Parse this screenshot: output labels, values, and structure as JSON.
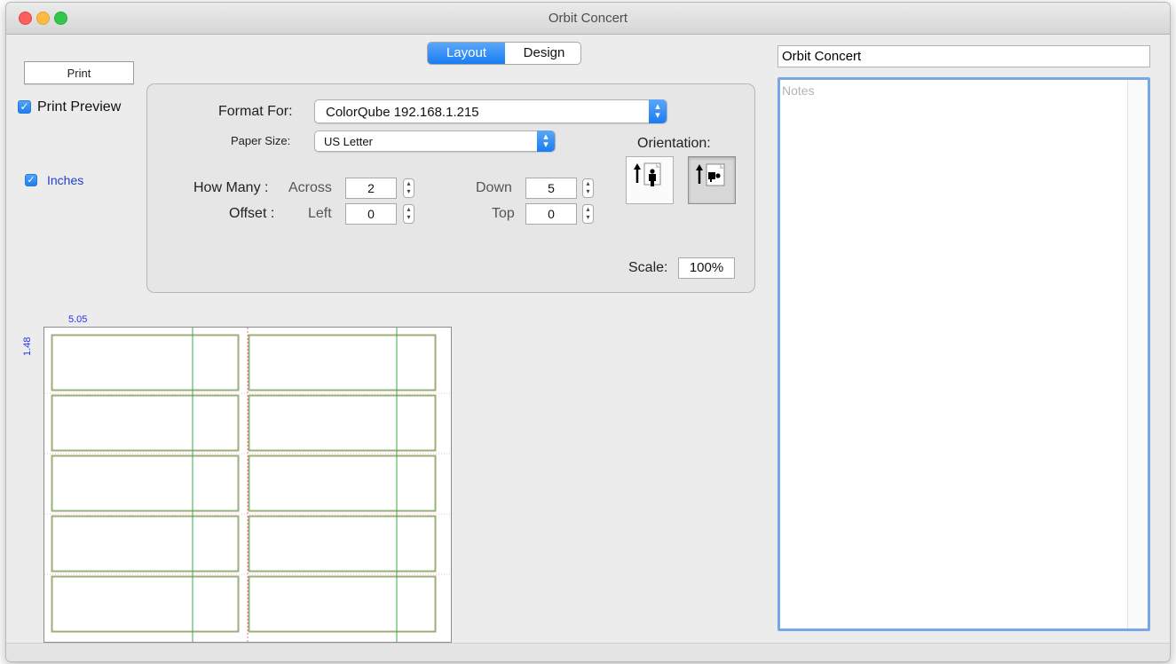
{
  "window": {
    "title": "Orbit Concert"
  },
  "tabs": {
    "layout": "Layout",
    "design": "Design",
    "selected": "Layout"
  },
  "left": {
    "print_label": "Print",
    "print_preview_label": "Print Preview",
    "print_preview_checked": true,
    "inches_label": "Inches",
    "inches_checked": true
  },
  "format": {
    "format_for_label": "Format For:",
    "format_for_value": "ColorQube 192.168.1.215",
    "paper_size_label": "Paper Size:",
    "paper_size_value": "US Letter",
    "orientation_label": "Orientation:",
    "orientation_selected": "landscape",
    "how_many_label": "How Many :",
    "across_label": "Across",
    "across_value": "2",
    "down_label": "Down",
    "down_value": "5",
    "offset_label": "Offset :",
    "left_label": "Left",
    "left_value": "0",
    "top_label": "Top",
    "top_value": "0",
    "scale_label": "Scale:",
    "scale_value": "100%"
  },
  "preview": {
    "width_label": "5.05",
    "height_label": "1.48",
    "columns": 2,
    "rows": 5,
    "colors": {
      "label_outline": "#c49a7a",
      "guide": "#3aa845",
      "dimension_text": "#2233ee"
    }
  },
  "right": {
    "name_value": "Orbit Concert",
    "notes_placeholder": "Notes",
    "notes_value": ""
  },
  "colors": {
    "accent": "#1a7cf2",
    "focus_ring": "#79a7e6"
  }
}
